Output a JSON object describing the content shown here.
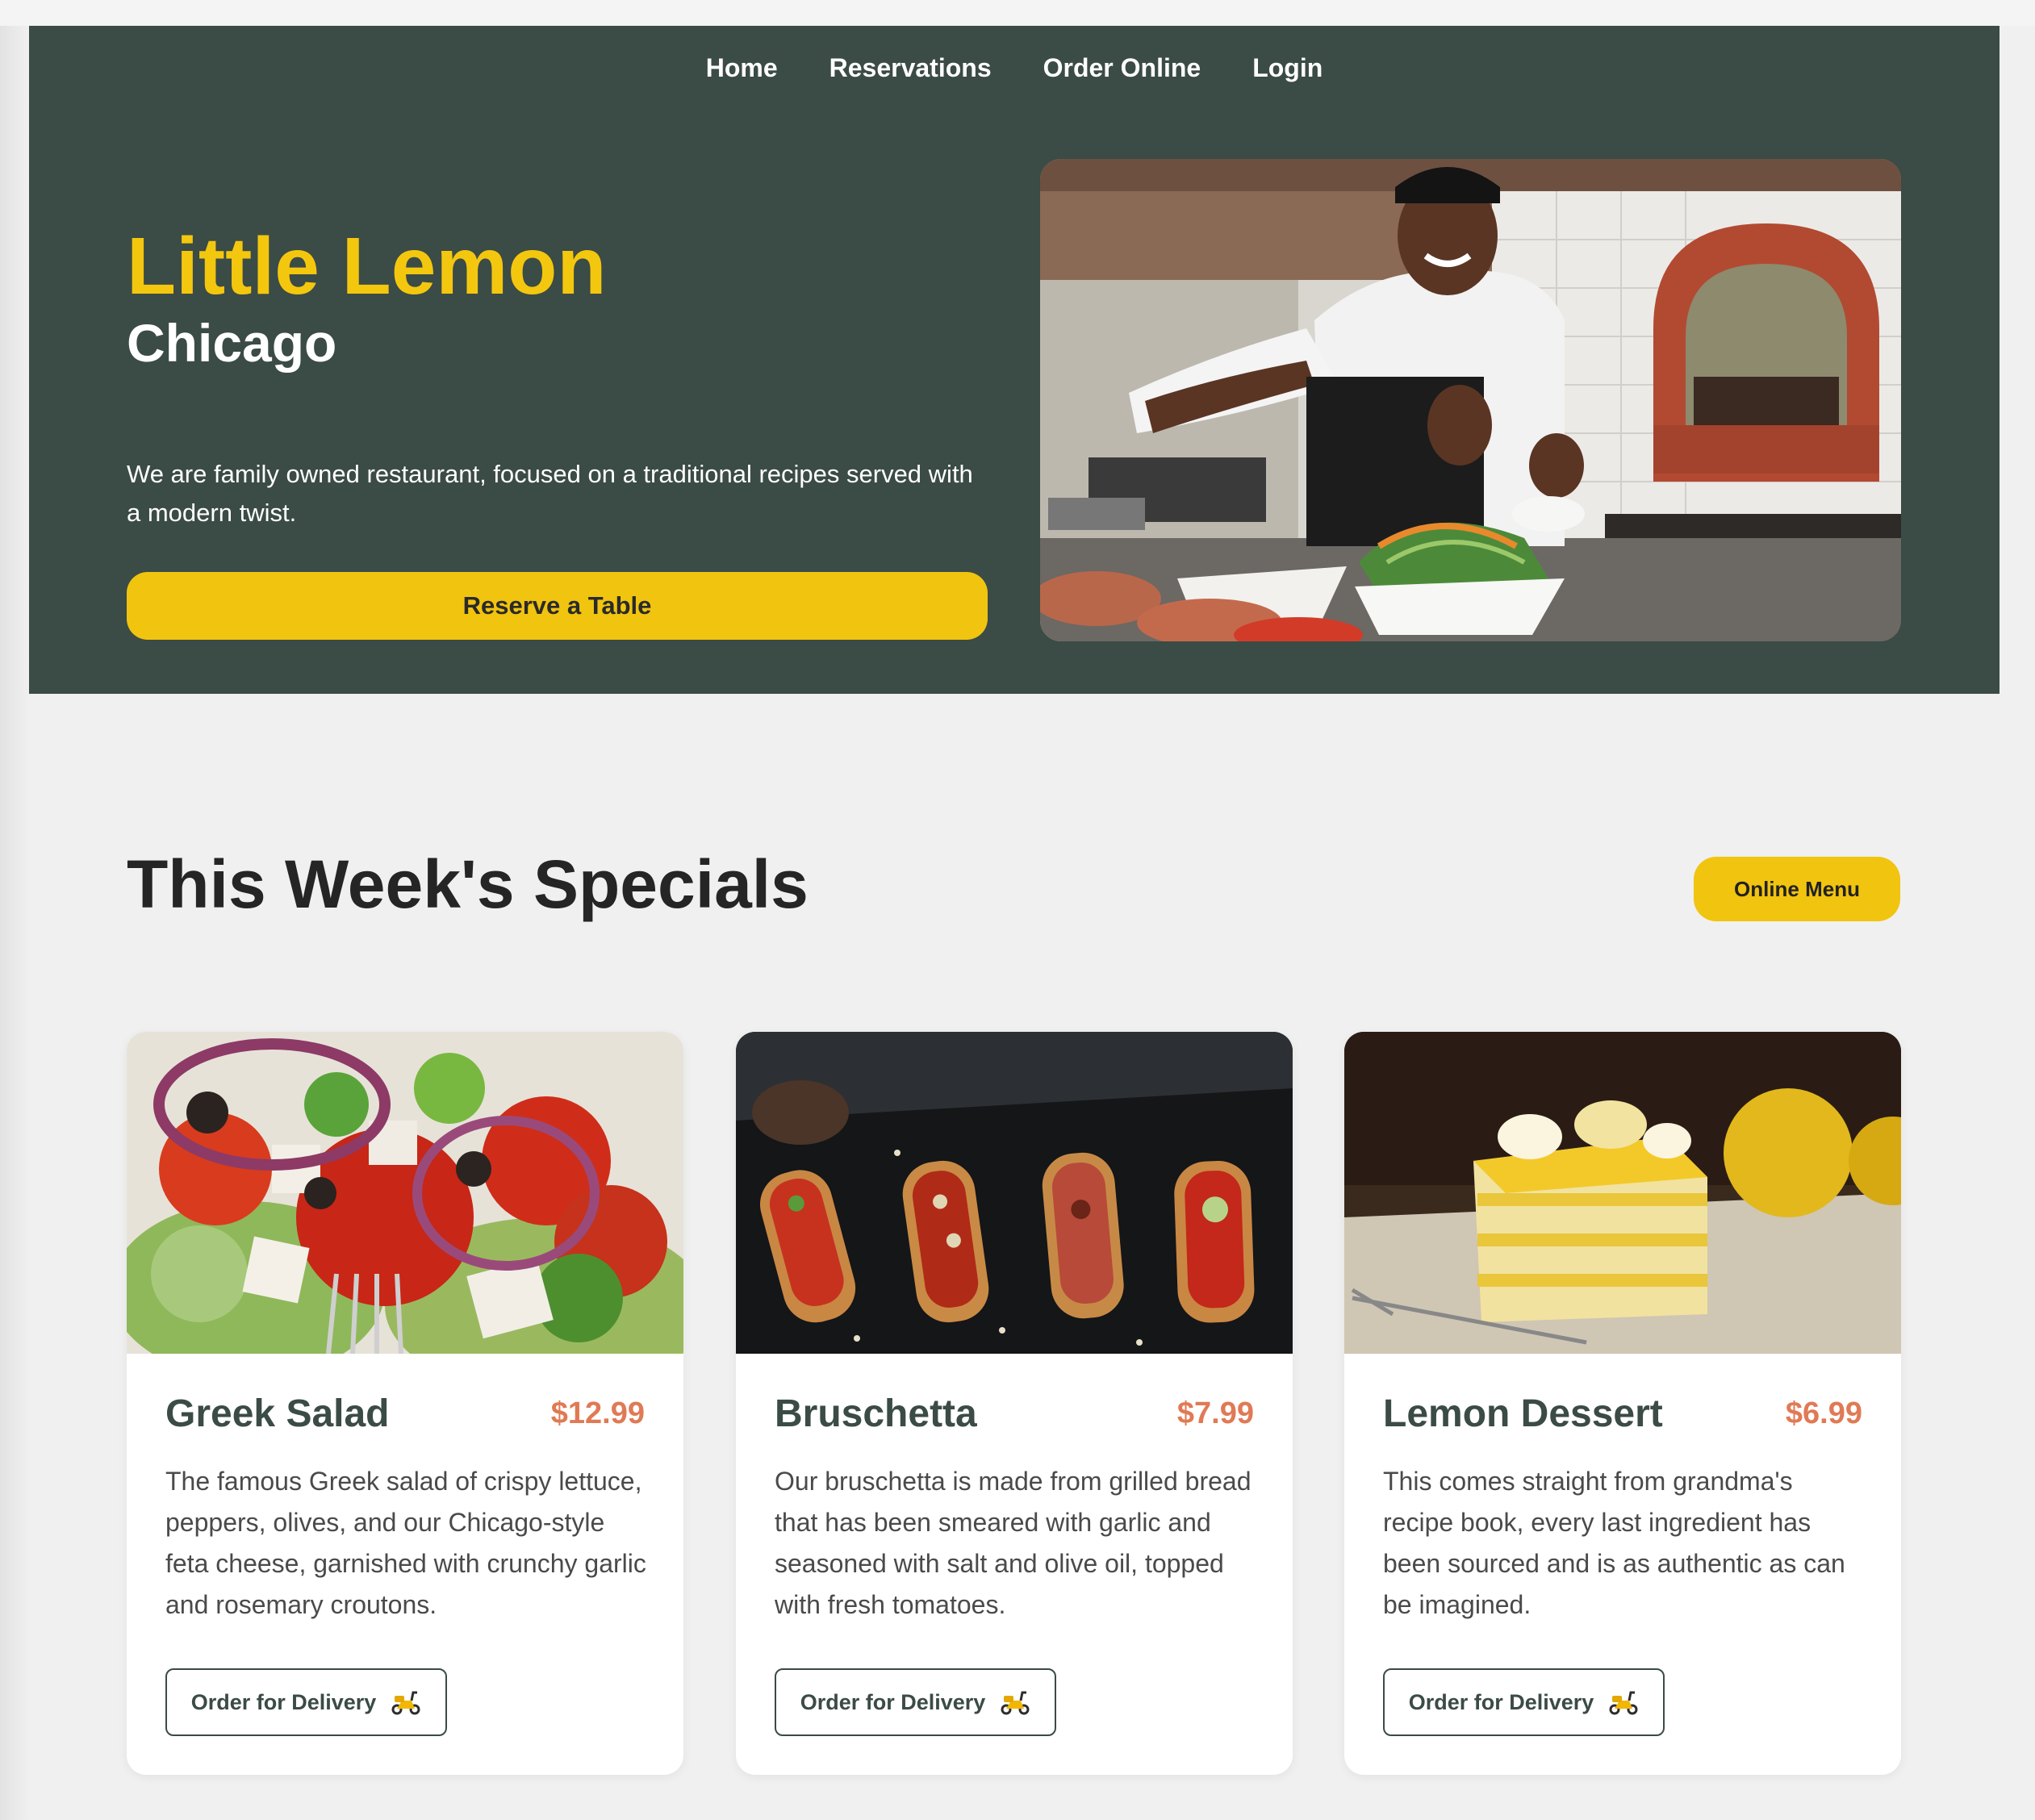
{
  "nav": {
    "items": [
      {
        "label": "Home"
      },
      {
        "label": "Reservations"
      },
      {
        "label": "Order Online"
      },
      {
        "label": "Login"
      }
    ]
  },
  "hero": {
    "title": "Little Lemon",
    "subtitle": "Chicago",
    "description": "We are family owned restaurant, focused on a traditional recipes served with a modern twist.",
    "cta_label": "Reserve a Table",
    "image_icon": "chef-photo"
  },
  "specials": {
    "title": "This Week's Specials",
    "menu_button": "Online Menu",
    "cards": [
      {
        "name": "Greek Salad",
        "price": "$12.99",
        "description": "The famous Greek salad of crispy lettuce, peppers, olives, and our Chicago-style feta cheese, garnished with crunchy garlic and rosemary croutons.",
        "order_label": "Order for Delivery",
        "order_icon": "scooter-icon"
      },
      {
        "name": "Bruschetta",
        "price": "$7.99",
        "description": "Our bruschetta is made from grilled bread that has been smeared with garlic and seasoned with salt and olive oil, topped with fresh tomatoes.",
        "order_label": "Order for Delivery",
        "order_icon": "scooter-icon"
      },
      {
        "name": "Lemon Dessert",
        "price": "$6.99",
        "description": "This comes straight from grandma's recipe book, every last ingredient has been sourced and is as authentic as can be imagined.",
        "order_label": "Order for Delivery",
        "order_icon": "scooter-icon"
      }
    ]
  },
  "colors": {
    "primary_green": "#3b4b45",
    "accent_yellow": "#f4c70f",
    "price_orange": "#e07a55",
    "page_bg": "#f0f0f0"
  }
}
